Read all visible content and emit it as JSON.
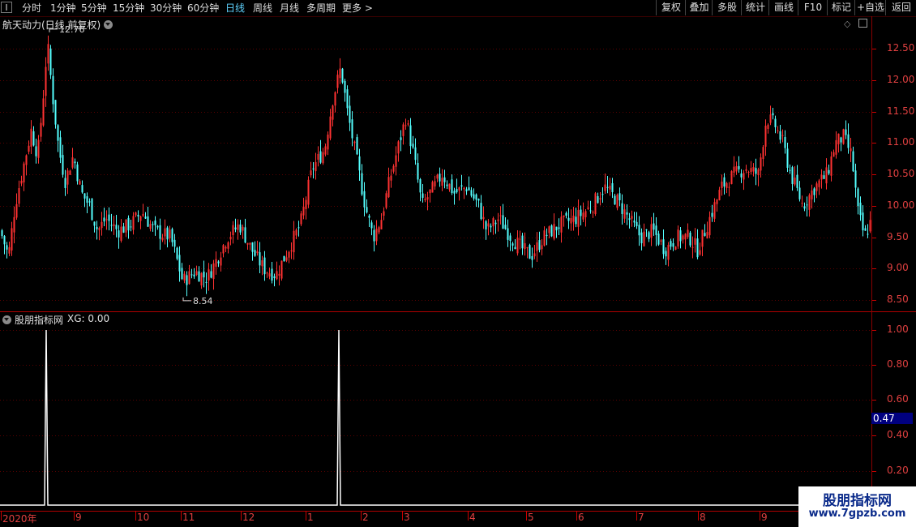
{
  "toolbar": {
    "periods": [
      "分时",
      "1分钟",
      "5分钟",
      "15分钟",
      "30分钟",
      "60分钟",
      "日线",
      "周线",
      "月线",
      "多周期",
      "更多 >"
    ],
    "active_period": "日线",
    "right_buttons": [
      "复权",
      "叠加",
      "多股",
      "统计",
      "画线",
      "F10",
      "标记",
      "+自选",
      "返回"
    ]
  },
  "price_panel": {
    "title": "航天动力(日线,前复权)",
    "y_ticks": [
      "12.50",
      "12.00",
      "11.50",
      "11.00",
      "10.50",
      "10.00",
      "9.50",
      "9.00",
      "8.50"
    ],
    "high_label": "12.76",
    "low_label": "8.54"
  },
  "indicator_panel": {
    "title": "股朋指标网",
    "xg_label": "XG: 0.00",
    "y_ticks": [
      "1.00",
      "0.80",
      "0.60",
      "0.40",
      "0.20"
    ],
    "cursor_value": "0.47"
  },
  "x_axis": {
    "labels": [
      "2020年",
      "9",
      "10",
      "11",
      "12",
      "1",
      "2",
      "3",
      "4",
      "5",
      "6",
      "7",
      "8",
      "9"
    ]
  },
  "watermark": {
    "line1": "股朋指标网",
    "line2": "www.7gpzb.com"
  },
  "colors": {
    "up": "#ff3232",
    "down": "#54ffff",
    "axis": "#c00000",
    "active": "#5fd3ff"
  },
  "chart_data": {
    "type": "candlestick",
    "title": "航天动力(日线,前复权)",
    "ylim": [
      8.4,
      12.8
    ],
    "high": 12.76,
    "low": 8.54,
    "indicator": {
      "name": "XG",
      "ylim": [
        0,
        1.05
      ],
      "signals": [
        {
          "x_month": "8",
          "value": 1.0
        },
        {
          "x_month": "1",
          "value": 1.0
        }
      ]
    }
  }
}
